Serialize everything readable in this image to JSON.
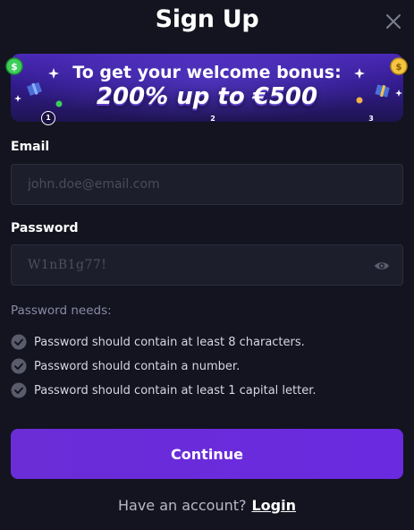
{
  "modal": {
    "title": "Sign Up"
  },
  "banner": {
    "line1": "To get your welcome bonus:",
    "line2": "200% up to €500",
    "steps": [
      "1",
      "2",
      "3"
    ],
    "current_step": 1
  },
  "form": {
    "email_label": "Email",
    "email_placeholder": "john.doe@email.com",
    "password_label": "Password",
    "password_value": "W1nB1g77!",
    "requirements_title": "Password needs:",
    "requirements": [
      "Password should contain at least 8 characters.",
      "Password should contain a number.",
      "Password should contain at least 1 capital letter."
    ],
    "continue_label": "Continue"
  },
  "footer": {
    "question": "Have an account?",
    "login_label": "Login"
  },
  "colors": {
    "background": "#13141f",
    "input_bg": "#1d1e2c",
    "accent": "#6a2dd6",
    "banner_top": "#4a2ab8"
  },
  "icons": {
    "close": "close-icon",
    "eye": "eye-icon",
    "check": "check-circle-icon"
  }
}
